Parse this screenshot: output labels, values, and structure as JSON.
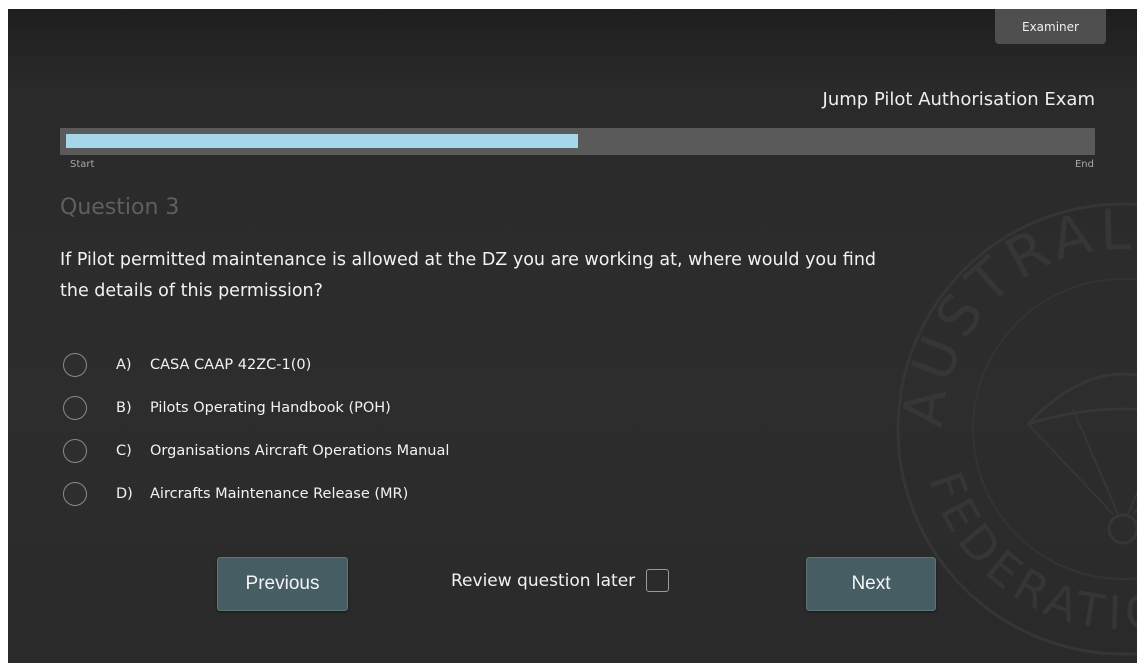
{
  "header": {
    "examiner_label": "Examiner",
    "exam_title": "Jump Pilot Authorisation Exam"
  },
  "progress": {
    "fraction": 0.5,
    "start_label": "Start",
    "end_label": "End",
    "fill_color": "#a6d7e8",
    "track_color": "#5a5a5a"
  },
  "question": {
    "number_label": "Question 3",
    "text": "If Pilot permitted maintenance is allowed at the DZ you are working at, where would you find the details of this permission?",
    "options": [
      {
        "letter": "A)",
        "text": "CASA CAAP 42ZC-1(0)",
        "selected": false
      },
      {
        "letter": "B)",
        "text": "Pilots Operating Handbook (POH)",
        "selected": false
      },
      {
        "letter": "C)",
        "text": "Organisations Aircraft Operations Manual",
        "selected": false
      },
      {
        "letter": "D)",
        "text": "Aircrafts Maintenance Release (MR)",
        "selected": false
      }
    ]
  },
  "navigation": {
    "previous_label": "Previous",
    "next_label": "Next",
    "review_label": "Review question later",
    "review_checked": false,
    "button_color": "#455d63"
  },
  "watermark": {
    "icon": "federation-seal-icon",
    "top_text": "AUSTRALIAN",
    "bottom_text": "FEDERATION"
  }
}
